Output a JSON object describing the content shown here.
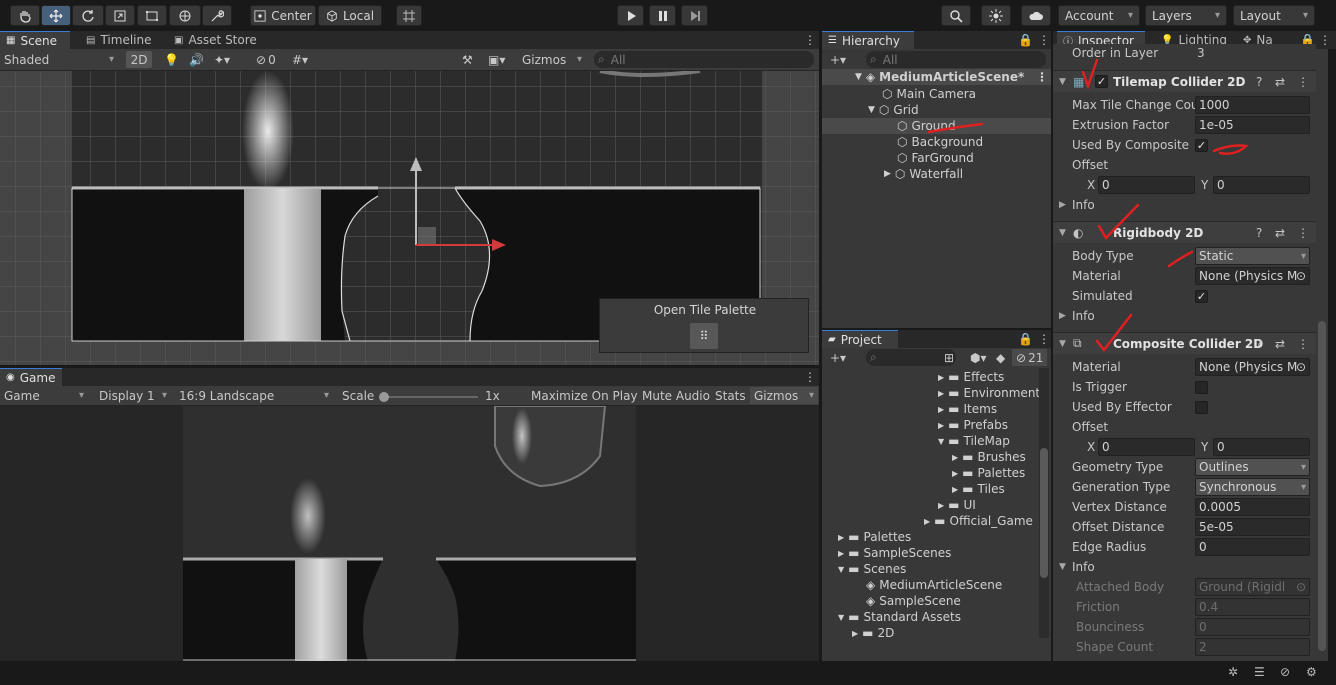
{
  "toolbar": {
    "pivot": "Center",
    "space": "Local",
    "account": "Account",
    "layers": "Layers",
    "layout": "Layout"
  },
  "scene": {
    "tabs": [
      "Scene",
      "Timeline",
      "Asset Store"
    ],
    "shading": "Shaded",
    "mode_2d": "2D",
    "hidden_count": "0",
    "gizmos": "Gizmos",
    "search_placeholder": "All",
    "popup_label": "Open Tile Palette"
  },
  "game": {
    "tab": "Game",
    "mode": "Game",
    "display": "Display 1",
    "aspect": "16:9 Landscape",
    "scale_label": "Scale",
    "scale_value": "1x",
    "maximize": "Maximize On Play",
    "mute": "Mute Audio",
    "stats": "Stats",
    "gizmos": "Gizmos"
  },
  "hierarchy": {
    "tab": "Hierarchy",
    "search_placeholder": "All",
    "items": [
      "MediumArticleScene*",
      "Main Camera",
      "Grid",
      "Ground",
      "Background",
      "FarGround",
      "Waterfall"
    ]
  },
  "project": {
    "tab": "Project",
    "count": "21",
    "items": [
      "Effects",
      "Environment",
      "Items",
      "Prefabs",
      "TileMap",
      "Brushes",
      "Palettes",
      "Tiles",
      "UI",
      "Official_Game",
      "Palettes",
      "SampleScenes",
      "Scenes",
      "MediumArticleScene",
      "SampleScene",
      "Standard Assets",
      "2D"
    ]
  },
  "inspector": {
    "tabs": [
      "Inspector",
      "Lighting",
      "Na"
    ],
    "order_label": "Order in Layer",
    "order_value": "3",
    "tilemap": {
      "title": "Tilemap Collider 2D",
      "max_label": "Max Tile Change Cou",
      "max_value": "1000",
      "extrusion_label": "Extrusion Factor",
      "extrusion_value": "1e-05",
      "composite_label": "Used By Composite",
      "offset_label": "Offset",
      "x_label": "X",
      "x_value": "0",
      "y_label": "Y",
      "y_value": "0",
      "info": "Info"
    },
    "rigidbody": {
      "title": "Rigidbody 2D",
      "body_type_label": "Body Type",
      "body_type_value": "Static",
      "material_label": "Material",
      "material_value": "None (Physics M",
      "simulated_label": "Simulated",
      "info": "Info"
    },
    "composite": {
      "title": "Composite Collider 2D",
      "material_label": "Material",
      "material_value": "None (Physics M",
      "trigger_label": "Is Trigger",
      "effector_label": "Used By Effector",
      "offset_label": "Offset",
      "x_label": "X",
      "x_value": "0",
      "y_label": "Y",
      "y_value": "0",
      "geometry_label": "Geometry Type",
      "geometry_value": "Outlines",
      "generation_label": "Generation Type",
      "generation_value": "Synchronous",
      "vertex_label": "Vertex Distance",
      "vertex_value": "0.0005",
      "offset_dist_label": "Offset Distance",
      "offset_dist_value": "5e-05",
      "edge_label": "Edge Radius",
      "edge_value": "0",
      "info": "Info",
      "attached_label": "Attached Body",
      "attached_value": "Ground (Rigidl",
      "friction_label": "Friction",
      "friction_value": "0.4",
      "bounciness_label": "Bounciness",
      "bounciness_value": "0",
      "shape_label": "Shape Count",
      "shape_value": "2"
    }
  },
  "colors": {
    "accent": "#3a7dd7",
    "annotation": "#e02020",
    "panel": "#383838"
  }
}
